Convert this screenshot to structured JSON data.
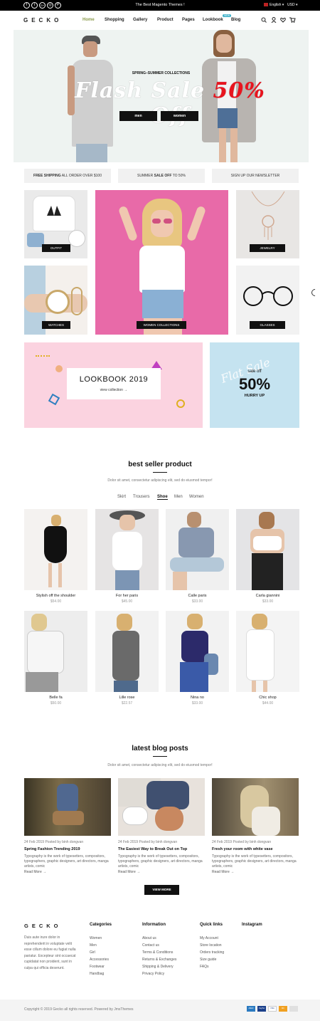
{
  "topbar": {
    "social": [
      "f",
      "t",
      "G+",
      "◎",
      "P"
    ],
    "promo": "The Best Magento Themes !",
    "language": "English",
    "currency": "USD"
  },
  "nav": {
    "logo": "GECKO",
    "items": [
      "Home",
      "Shopping",
      "Gallery",
      "Product",
      "Pages",
      "Lookbook",
      "Blog"
    ],
    "badge": "NEW"
  },
  "hero": {
    "kicker": "SPRING–SUMMER COLLECTIONS",
    "headline_a": "Flash Sale",
    "headline_b": "50%",
    "headline_c": "Off",
    "btn_men": "men",
    "btn_women": "women"
  },
  "pills": [
    {
      "bold": "FREE SHIPPING",
      "rest": " ALL ORDER OVER $100"
    },
    {
      "pre": "SUMMER ",
      "bold": "SALE OFF",
      "rest": " TO 50%"
    },
    {
      "rest": "SIGN UP OUR NEWSLETTER"
    }
  ],
  "categories": {
    "outfit": "OUTFIT",
    "watches": "WATCHES",
    "women": "WOMEN COLLECTIONS",
    "jewelry": "JEWELRY",
    "glasses": "GLASSES"
  },
  "lookbook": {
    "title": "LOOKBOOK 2019",
    "link": "view collection →"
  },
  "sale": {
    "small": "sale off",
    "big": "50%",
    "sub": "HURRY UP",
    "script": "Flat Sale"
  },
  "bestseller": {
    "title": "best seller product",
    "desc": "Dolor sit amet, consectetur adipiscing elit, sed do eiusmod tempor!",
    "tabs": [
      "Skirt",
      "Trousers",
      "Shoe",
      "Men",
      "Women"
    ],
    "products": [
      {
        "name": "Stylish off the shoulder",
        "price": "$54.00"
      },
      {
        "name": "For her paris",
        "price": "$45.00"
      },
      {
        "name": "Calle paris",
        "price": "$33.00"
      },
      {
        "name": "Carla giannini",
        "price": "$33.00"
      },
      {
        "name": "Belle fa",
        "price": "$50.00"
      },
      {
        "name": "Lille rose",
        "price": "$22.57"
      },
      {
        "name": "Nina no",
        "price": "$33.00"
      },
      {
        "name": "Chic shop",
        "price": "$44.00"
      }
    ]
  },
  "blog": {
    "title": "latest blog posts",
    "desc": "Dolor sit amet, consectetur adipiscing elit, sed do eiusmod tempor!",
    "posts": [
      {
        "meta": "24 Feb 2019 Posted by binh dongvan",
        "title": "Spring Fashion Trending 2019",
        "body": "Typography is the work of typesetters, compositors, typographers, graphic designers, art directors, manga artists, comic",
        "more": "Read More →"
      },
      {
        "meta": "24 Feb 2019 Posted by binh dongvan",
        "title": "The Easiest Way to Break Out on Top",
        "body": "Typography is the work of typesetters, compositors, typographers, graphic designers, art directors, manga artists, comic",
        "more": "Read More →"
      },
      {
        "meta": "24 Feb 2019 Posted by binh dongvan",
        "title": "Fresh your room with white vase",
        "body": "Typography is the work of typesetters, compositors, typographers, graphic designers, art directors, manga artists, comic",
        "more": "Read More →"
      }
    ],
    "view_more": "VIEW MORE"
  },
  "footer": {
    "logo": "GECKO",
    "about": "Duis aute irure dolor in reprehenderit in voluptate velit esse cillum dolore eu fugiat nulla pariatur. Excepteur sint occaecat cupidatat non proident, sunt in culpa qui officia deserunt.",
    "cols": [
      {
        "title": "Categories",
        "links": [
          "Women",
          "Men",
          "Girl",
          "Accessories",
          "Footwear",
          "Handbag"
        ]
      },
      {
        "title": "Information",
        "links": [
          "About us",
          "Contact us",
          "Terms & Conditions",
          "Returns & Exchanges",
          "Shipping & Delivery",
          "Privacy Policy"
        ]
      },
      {
        "title": "Quick links",
        "links": [
          "My Account",
          "Store location",
          "Orders tracking",
          "Size guide",
          "FAQs"
        ]
      },
      {
        "title": "Instagram",
        "links": []
      }
    ],
    "copyright": "Copyright © 2019 Gecko all rights reserved. Powered by JmsThemes",
    "payments": [
      "AMEX",
      "PayPal",
      "VISA",
      "MC"
    ]
  }
}
